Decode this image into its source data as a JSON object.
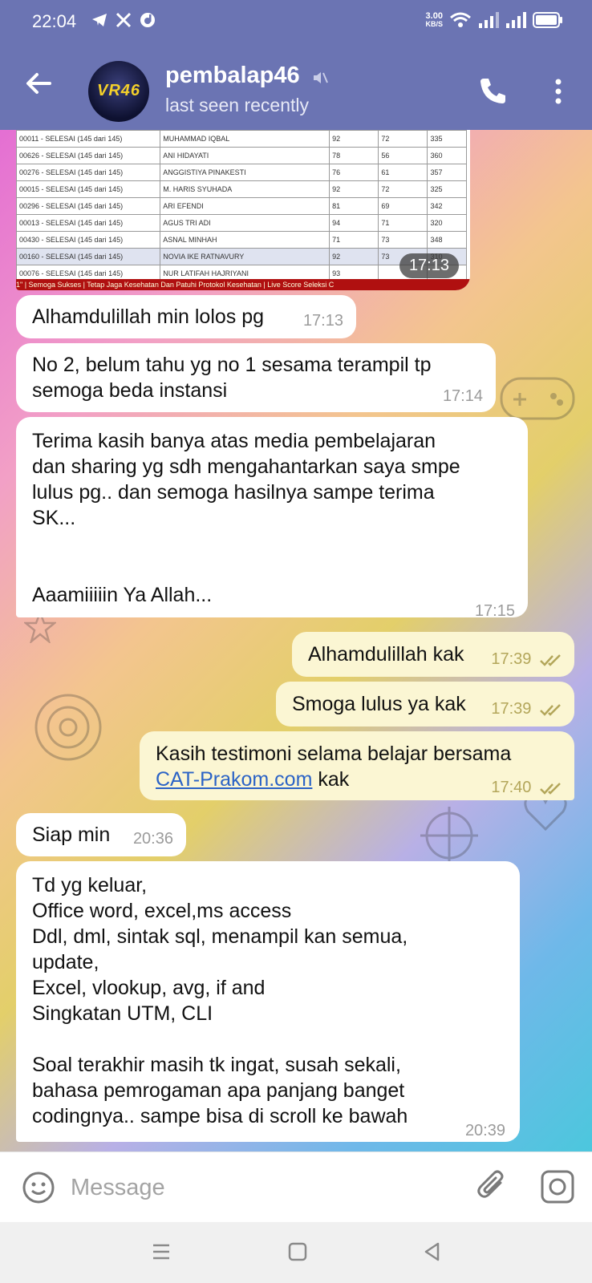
{
  "status_bar": {
    "time": "22:04",
    "left_icons": [
      "telegram-icon",
      "x-icon",
      "d-app-icon"
    ],
    "net_speed_value": "3.00",
    "net_speed_unit": "KB/S",
    "right_icons": [
      "wifi-icon",
      "signal-icon",
      "signal-icon",
      "battery-icon"
    ]
  },
  "header": {
    "title": "pembalap46",
    "subtitle": "last seen recently",
    "avatar_text": "VR46",
    "icons": [
      "back-arrow-icon",
      "muted-icon",
      "phone-icon",
      "more-vertical-icon"
    ]
  },
  "image_message": {
    "time": "17:13",
    "rows": [
      [
        "00011 - SELESAI (145 dari 145)",
        "MUHAMMAD IQBAL",
        "92",
        "72",
        "335"
      ],
      [
        "00626 - SELESAI (145 dari 145)",
        "ANI HIDAYATI",
        "78",
        "56",
        "360"
      ],
      [
        "00276 - SELESAI (145 dari 145)",
        "ANGGISTIYA PINAKESTI",
        "76",
        "61",
        "357"
      ],
      [
        "00015 - SELESAI (145 dari 145)",
        "M. HARIS SYUHADA",
        "92",
        "72",
        "325"
      ],
      [
        "00296 - SELESAI (145 dari 145)",
        "ARI EFENDI",
        "81",
        "69",
        "342"
      ],
      [
        "00013 - SELESAI (145 dari 145)",
        "AGUS TRI ADI",
        "94",
        "71",
        "320"
      ],
      [
        "00430 - SELESAI (145 dari 145)",
        "ASNAL MINHAH",
        "71",
        "73",
        "348"
      ],
      [
        "00160 - SELESAI (145 dari 145)",
        "NOVIA IKE RATNAVURY",
        "92",
        "73",
        "310"
      ],
      [
        "00076 - SELESAI (145 dari 145)",
        "NUR LATIFAH HAJRIYANI",
        "93",
        "",
        ""
      ]
    ],
    "ticker": "1\" | Semoga Sukses | Tetap Jaga Kesehatan Dan Patuhi Protokol Kesehatan | Live Score Seleksi C"
  },
  "messages": [
    {
      "dir": "in",
      "text": "Alhamdulillah min lolos pg",
      "time": "17:13"
    },
    {
      "dir": "in",
      "text": "No 2, belum tahu yg no 1 sesama terampil tp\nsemoga beda instansi",
      "time": "17:14"
    },
    {
      "dir": "in",
      "text": "Terima kasih banya atas media pembelajaran\ndan sharing yg sdh mengahantarkan saya smpe\nlulus pg.. dan semoga hasilnya sampe terima\nSK...\n\n\nAaamiiiiin Ya Allah...",
      "time": "17:15"
    },
    {
      "dir": "out",
      "text": "Alhamdulillah kak",
      "time": "17:39"
    },
    {
      "dir": "out",
      "text": "Smoga lulus ya kak",
      "time": "17:39"
    },
    {
      "dir": "out",
      "text_prefix": "Kasih testimoni selama belajar bersama",
      "link": "CAT-Prakom.com",
      "text_suffix": " kak",
      "time": "17:40"
    },
    {
      "dir": "in",
      "text": "Siap min",
      "time": "20:36"
    },
    {
      "dir": "in",
      "text": "Td yg keluar,\nOffice word, excel,ms access\nDdl, dml, sintak sql, menampil kan semua,\nupdate,\nExcel, vlookup, avg, if and\nSingkatan UTM, CLI\n\nSoal terakhir masih tk ingat, susah sekali,\nbahasa pemrogaman apa panjang banget\ncodingnya.. sampe bisa di scroll ke bawah",
      "time": "20:39"
    }
  ],
  "input_bar": {
    "placeholder": "Message",
    "icons": [
      "emoji-icon",
      "attach-icon",
      "camera-icon"
    ]
  },
  "nav_bar": {
    "icons": [
      "menu-icon",
      "home-icon",
      "back-icon"
    ]
  },
  "colors": {
    "header": "#6b74b3",
    "incoming_bubble": "#ffffff",
    "outgoing_bubble": "#fbf6d3",
    "link": "#2b63c6",
    "read_ticks": "#b3a65a"
  }
}
